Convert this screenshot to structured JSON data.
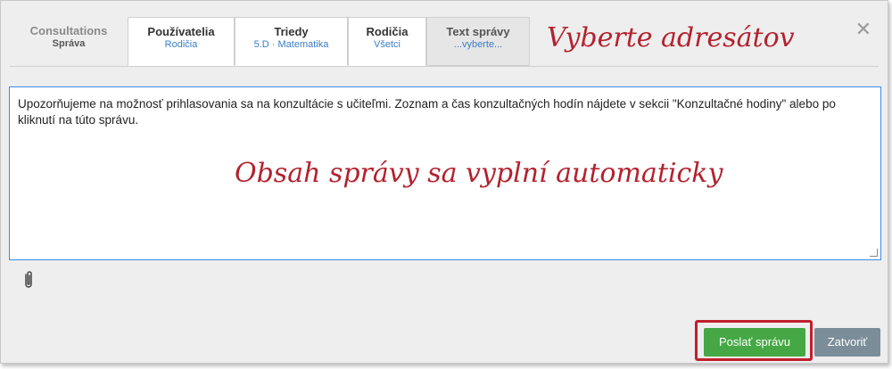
{
  "tabs": [
    {
      "title": "Consultations",
      "sub": "Správa"
    },
    {
      "title": "Používatelia",
      "sub": "Rodičia"
    },
    {
      "title": "Triedy",
      "sub": "5.D · Matematika"
    },
    {
      "title": "Rodičia",
      "sub": "Všetci"
    },
    {
      "title": "Text správy",
      "sub": "...vyberte..."
    }
  ],
  "hints": {
    "recipients": "Vyberte adresátov",
    "content": "Obsah správy sa vyplní automaticky"
  },
  "message": {
    "text": "Upozorňujeme na možnosť prihlasovania sa na konzultácie s učiteľmi. Zoznam a čas konzultačných hodín nájdete v sekcii \"Konzultačné hodiny\" alebo po kliknutí na túto správu."
  },
  "buttons": {
    "send": "Poslať správu",
    "close": "Zatvoriť"
  },
  "icons": {
    "close": "close-icon",
    "attachment": "paperclip-icon"
  },
  "colors": {
    "accent_blue": "#3c8ce7",
    "send_green": "#45a845",
    "close_grey": "#7b8d98",
    "hint_red": "#b3222e"
  }
}
